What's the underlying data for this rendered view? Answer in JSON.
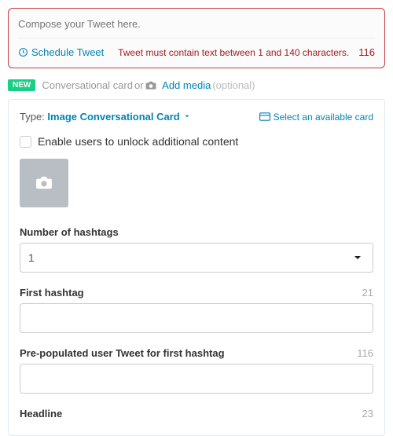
{
  "compose": {
    "placeholder": "Compose your Tweet here.",
    "schedule_label": "Schedule Tweet",
    "error": "Tweet must contain text between 1 and 140 characters.",
    "count": "116"
  },
  "subhead": {
    "badge": "NEW",
    "text_a": "Conversational card",
    "text_or": " or ",
    "add_media": "Add media",
    "optional": " (optional)"
  },
  "card": {
    "type_prefix": "Type: ",
    "type_value": "Image Conversational Card",
    "select_card": "Select an available card",
    "enable_label": "Enable users to unlock additional content",
    "fields": {
      "num_hashtags": {
        "label": "Number of hashtags",
        "value": "1"
      },
      "first_hashtag": {
        "label": "First hashtag",
        "value": "",
        "count": "21"
      },
      "prepop": {
        "label": "Pre-populated user Tweet for first hashtag",
        "value": "",
        "count": "116"
      },
      "headline": {
        "label": "Headline",
        "count": "23"
      }
    }
  }
}
